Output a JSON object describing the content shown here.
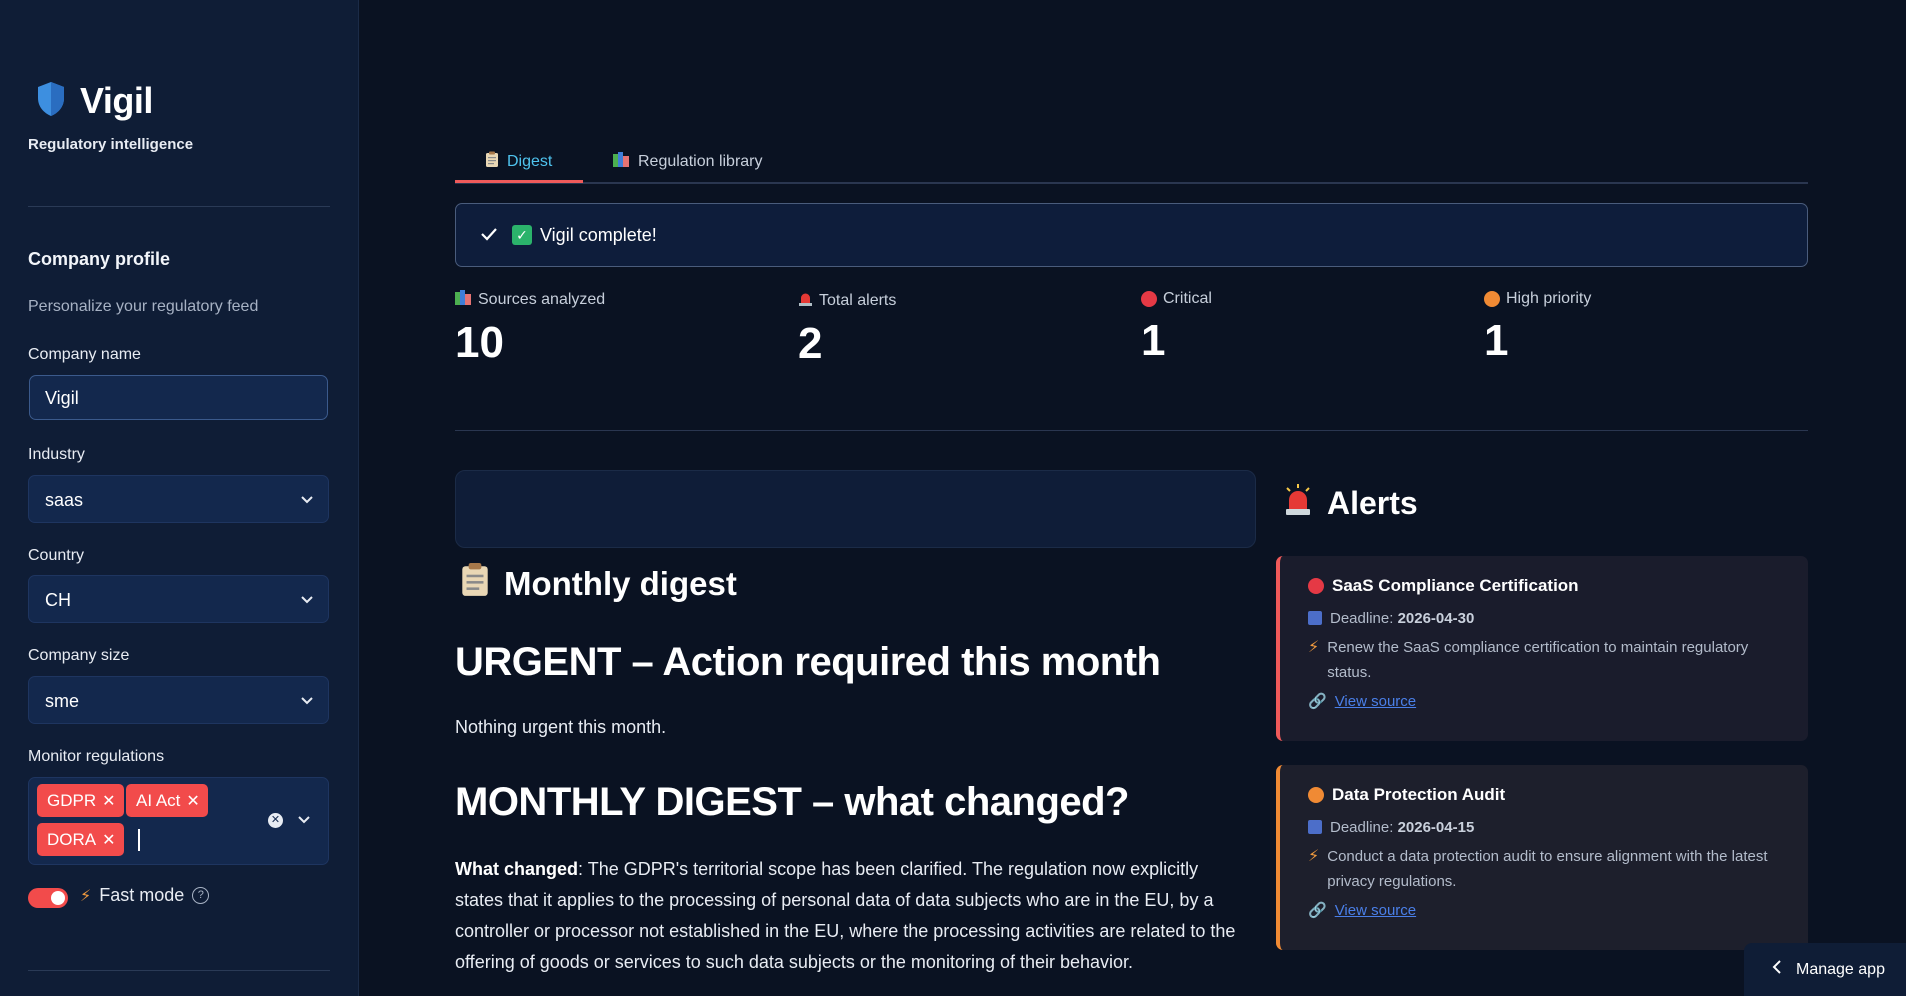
{
  "sidebar": {
    "brand_title": "Vigil",
    "brand_subtitle": "Regulatory intelligence",
    "section_title": "Company profile",
    "section_caption": "Personalize your regulatory feed",
    "company_name": {
      "label": "Company name",
      "value": "Vigil"
    },
    "industry": {
      "label": "Industry",
      "value": "saas"
    },
    "country": {
      "label": "Country",
      "value": "CH"
    },
    "company_size": {
      "label": "Company size",
      "value": "sme"
    },
    "monitor": {
      "label": "Monitor regulations",
      "chips": [
        "GDPR",
        "AI Act",
        "DORA"
      ]
    },
    "fast_mode": {
      "label": "Fast mode",
      "enabled": true
    }
  },
  "tabs": [
    {
      "label": "Digest",
      "active": true
    },
    {
      "label": "Regulation library",
      "active": false
    }
  ],
  "status": {
    "message": "Vigil complete!"
  },
  "metrics": [
    {
      "label": "Sources analyzed",
      "value": "10"
    },
    {
      "label": "Total alerts",
      "value": "2"
    },
    {
      "label": "Critical",
      "value": "1"
    },
    {
      "label": "High priority",
      "value": "1"
    }
  ],
  "digest": {
    "title": "Monthly digest",
    "urgent_heading": "URGENT – Action required this month",
    "urgent_text": "Nothing urgent this month.",
    "monthly_heading": "MONTHLY DIGEST – what changed?",
    "changed_label": "What changed",
    "changed_text": ": The GDPR's territorial scope has been clarified. The regulation now explicitly states that it applies to the processing of personal data of data subjects who are in the EU, by a controller or processor not established in the EU, where the processing activities are related to the offering of goods or services to such data subjects or the monitoring of their behavior."
  },
  "alerts": {
    "title": "Alerts",
    "items": [
      {
        "title": "SaaS Compliance Certification",
        "deadline_label": "Deadline:",
        "deadline": "2026-04-30",
        "action": "Renew the SaaS compliance certification to maintain regulatory status.",
        "link": "View source",
        "color": "#f05a5a"
      },
      {
        "title": "Data Protection Audit",
        "deadline_label": "Deadline:",
        "deadline": "2026-04-15",
        "action": "Conduct a data protection audit to ensure alignment with the latest privacy regulations.",
        "link": "View source",
        "color": "#f08a34"
      }
    ]
  },
  "footer": {
    "manage_app": "Manage app"
  },
  "colors": {
    "accent": "#4fc3ee",
    "danger": "#f05a5a",
    "warning": "#f08a34",
    "chip": "#f24b4b"
  }
}
